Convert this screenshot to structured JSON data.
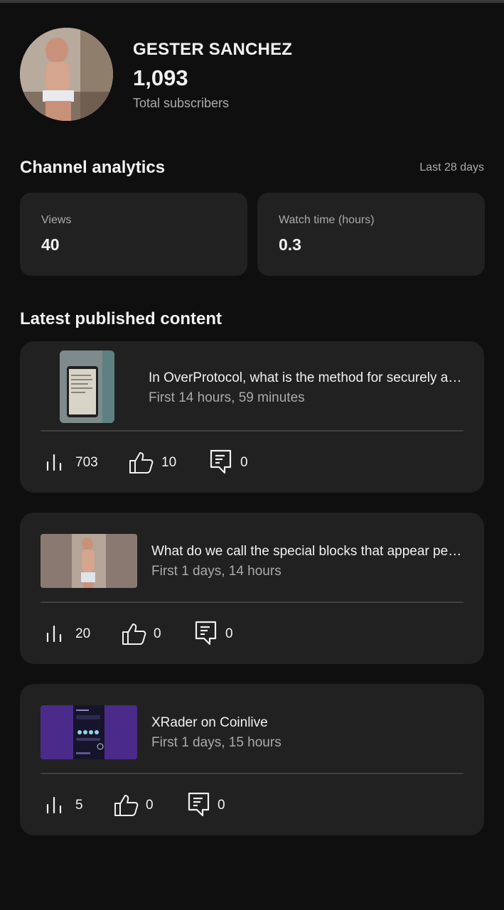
{
  "channel": {
    "name": "GESTER SANCHEZ",
    "subscribers": "1,093",
    "subscribers_label": "Total subscribers"
  },
  "analytics": {
    "title": "Channel analytics",
    "period": "Last 28 days",
    "cards": [
      {
        "label": "Views",
        "value": "40"
      },
      {
        "label": "Watch time (hours)",
        "value": "0.3"
      }
    ]
  },
  "latest": {
    "title": "Latest published content",
    "items": [
      {
        "title": "In OverProtocol, what is the method for securely ac...",
        "age": "First 14 hours, 59 minutes",
        "views": "703",
        "likes": "10",
        "comments": "0"
      },
      {
        "title": "What do we call the special blocks that appear peri...",
        "age": "First 1 days, 14 hours",
        "views": "20",
        "likes": "0",
        "comments": "0"
      },
      {
        "title": "XRader on Coinlive",
        "age": "First 1 days, 15 hours",
        "views": "5",
        "likes": "0",
        "comments": "0"
      }
    ]
  },
  "colors": {
    "background": "#0f0f0f",
    "card": "#212121",
    "text_primary": "#f1f1f1",
    "text_secondary": "#aaaaaa",
    "divider": "#3f3f3f"
  },
  "icons": {
    "views": "bar-chart-icon",
    "likes": "thumbs-up-icon",
    "comments": "comment-icon"
  }
}
